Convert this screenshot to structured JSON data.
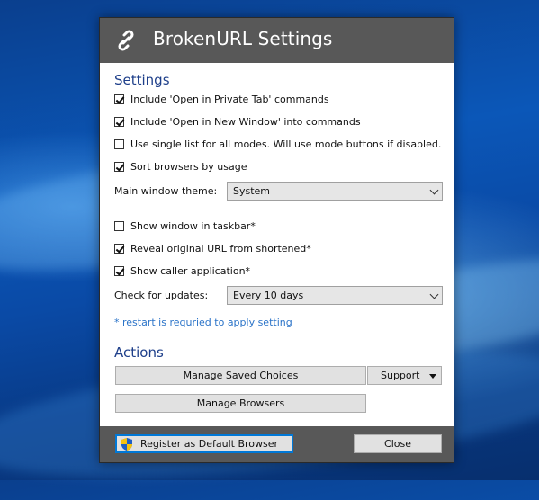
{
  "window": {
    "title": "BrokenURL Settings",
    "icon": "link-icon"
  },
  "settings": {
    "heading": "Settings",
    "options": [
      {
        "label": "Include 'Open in Private Tab' commands",
        "checked": true
      },
      {
        "label": "Include 'Open in New Window' into commands",
        "checked": true
      },
      {
        "label": "Use single list for all modes. Will use mode buttons if disabled.",
        "checked": false
      },
      {
        "label": "Sort browsers by usage",
        "checked": true
      }
    ],
    "theme": {
      "label": "Main window theme:",
      "value": "System"
    },
    "options2": [
      {
        "label": "Show window in taskbar*",
        "checked": false
      },
      {
        "label": "Reveal original URL from shortened*",
        "checked": true
      },
      {
        "label": "Show caller application*",
        "checked": true
      }
    ],
    "updates": {
      "label": "Check for updates:",
      "value": "Every 10 days"
    },
    "note": "* restart is requried to apply setting"
  },
  "actions": {
    "heading": "Actions",
    "manage_saved_choices": "Manage Saved Choices",
    "support": "Support",
    "manage_browsers": "Manage Browsers"
  },
  "footer": {
    "register_default": "Register as Default Browser",
    "register_icon": "uac-shield-icon",
    "close": "Close"
  },
  "colors": {
    "titlebar": "#585858",
    "section_heading": "#1e3f8a",
    "note": "#2a73c8",
    "focus_border": "#0078d7"
  }
}
